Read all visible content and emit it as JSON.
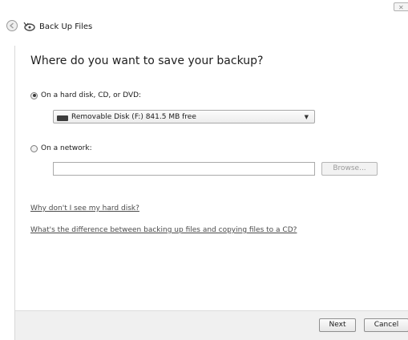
{
  "window": {
    "title": "Back Up Files",
    "close_glyph": "✕"
  },
  "icons": {
    "back": "back-arrow-icon",
    "wizard": "backup-wizard-icon",
    "disk": "removable-disk-icon",
    "dropdown": "chevron-down-icon"
  },
  "main": {
    "heading": "Where do you want to save your backup?",
    "option_local": {
      "label": "On a hard disk, CD, or DVD:",
      "selected": true
    },
    "drive_select": {
      "value": "Removable Disk (F:)  841.5 MB free",
      "arrow": "▼"
    },
    "option_network": {
      "label": "On a network:",
      "selected": false
    },
    "network_path": {
      "value": "",
      "placeholder": ""
    },
    "browse_label": "Browse...",
    "link_hard_disk": "Why don't I see my hard disk?",
    "link_difference": "What's the difference between backing up files and copying files to a CD?"
  },
  "footer": {
    "next_label": "Next",
    "cancel_label": "Cancel"
  }
}
